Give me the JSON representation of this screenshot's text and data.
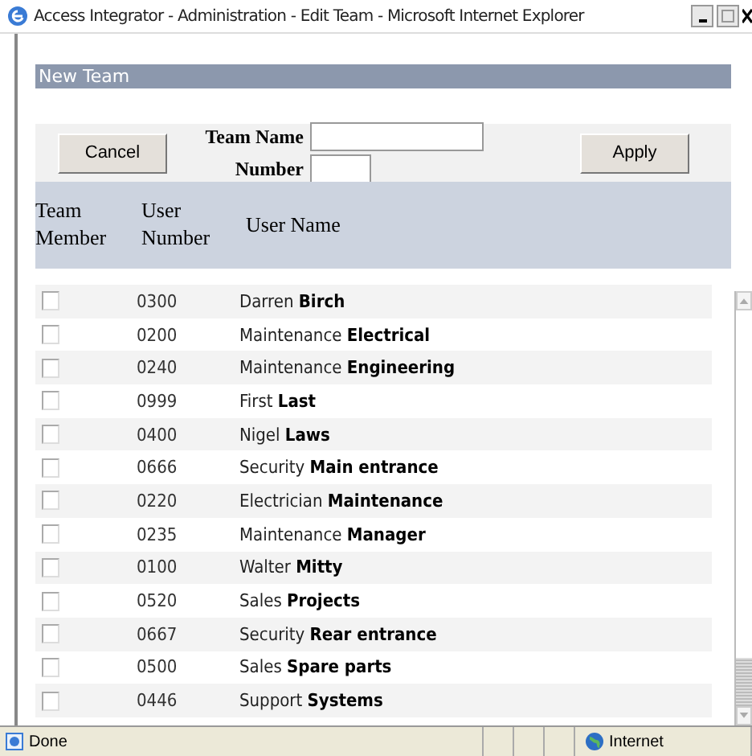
{
  "window": {
    "title": "Access Integrator - Administration - Edit Team - Microsoft Internet Explorer"
  },
  "section_title": "New Team",
  "form": {
    "cancel": "Cancel",
    "team_name_label": "Team Name",
    "number_label": "Number",
    "apply": "Apply"
  },
  "table": {
    "columns": [
      "Team Member",
      "User Number",
      "User Name"
    ],
    "rows": [
      {
        "checked": false,
        "number": "0300",
        "name": "Darren **Birch**"
      },
      {
        "checked": false,
        "number": "0200",
        "name": "Maintenance **Electrical**"
      },
      {
        "checked": false,
        "number": "0240",
        "name": "Maintenance **Engineering**"
      },
      {
        "checked": false,
        "number": "0999",
        "name": "First **Last**"
      },
      {
        "checked": false,
        "number": "0400",
        "name": "Nigel **Laws**"
      },
      {
        "checked": false,
        "number": "0666",
        "name": "Security **Main entrance**"
      },
      {
        "checked": false,
        "number": "0220",
        "name": "Electrician **Maintenance**"
      },
      {
        "checked": false,
        "number": "0235",
        "name": "Maintenance **Manager**"
      },
      {
        "checked": false,
        "number": "0100",
        "name": "Walter **Mitty**"
      },
      {
        "checked": false,
        "number": "0520",
        "name": "Sales **Projects**"
      },
      {
        "checked": false,
        "number": "0667",
        "name": "Security **Rear entrance**"
      },
      {
        "checked": false,
        "number": "0500",
        "name": "Sales **Spare parts**"
      },
      {
        "checked": false,
        "number": "0446",
        "name": "Support **Systems**"
      }
    ]
  },
  "status_bar": {
    "status": "Done",
    "zone": "Internet"
  }
}
